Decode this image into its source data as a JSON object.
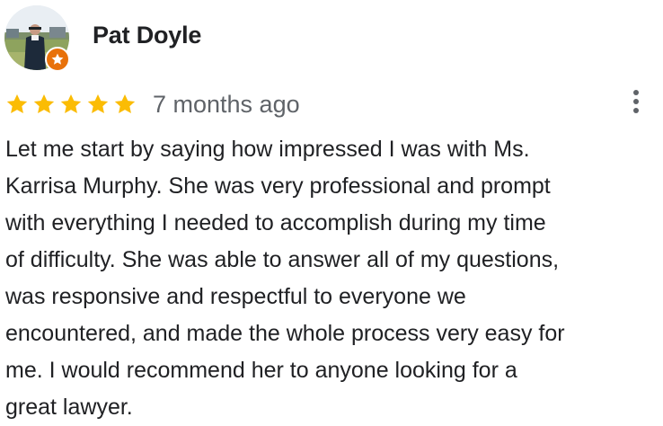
{
  "review": {
    "author": "Pat Doyle",
    "rating": 5,
    "rating_max": 5,
    "date": "7 months ago",
    "text": "Let me start by saying how impressed I was with Ms.\nKarrisa Murphy. She was very professional and prompt\nwith everything I needed to accomplish during my time\nof difficulty. She was able to answer all of my questions,\nwas responsive and respectful to everyone we\nencountered, and made the whole process very easy for\nme. I would recommend her to anyone looking for a\ngreat lawyer."
  },
  "icons": {
    "star": "star-icon",
    "badge": "local-guide-star-icon",
    "more": "more-vertical-icon"
  },
  "colors": {
    "star": "#fbbc04",
    "badge": "#e8710a",
    "author_text": "#202124",
    "meta_text": "#5f6368"
  }
}
